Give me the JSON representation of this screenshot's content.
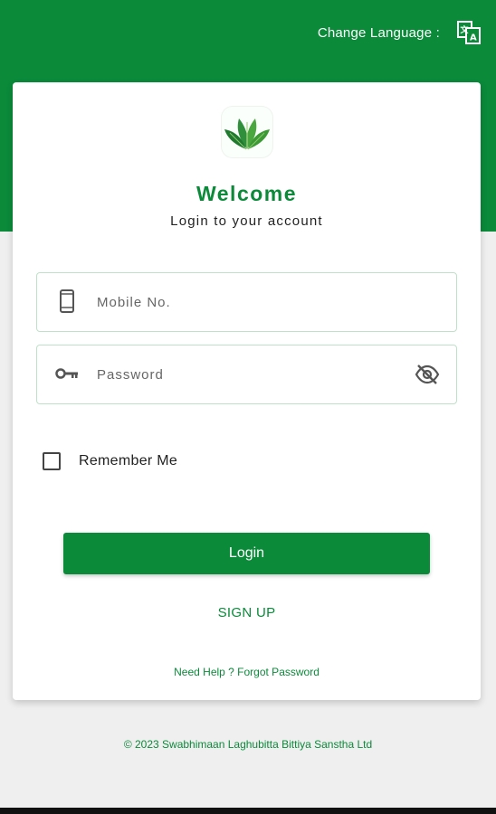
{
  "header": {
    "change_language_label": "Change Language :",
    "language_icon": "translate-icon"
  },
  "brand": {
    "logo_icon": "leaf-logo-icon",
    "welcome_title": "Welcome",
    "subtitle": "Login to your account"
  },
  "form": {
    "mobile": {
      "icon": "mobile-phone-icon",
      "placeholder": "Mobile No.",
      "value": ""
    },
    "password": {
      "icon": "key-icon",
      "placeholder": "Password",
      "value": "",
      "toggle_icon": "eye-off-icon"
    },
    "remember_me_label": "Remember Me",
    "remember_me_checked": false
  },
  "actions": {
    "login_label": "Login",
    "signup_label": "SIGN UP",
    "help_text": "Need Help ? Forgot Password"
  },
  "footer": {
    "copyright": "© 2023 Swabhimaan Laghubitta Bittiya Sanstha Ltd"
  },
  "colors": {
    "brand_green": "#0b8a3a",
    "background": "#efefef",
    "card": "#ffffff",
    "field_border": "#bfe1c9"
  }
}
